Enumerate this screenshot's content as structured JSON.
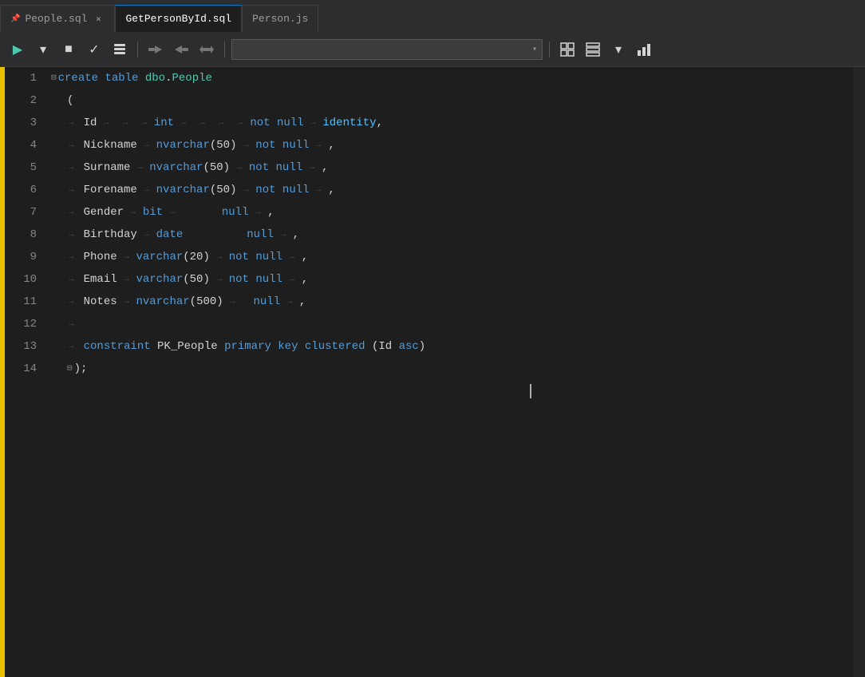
{
  "tabs": [
    {
      "id": "people-sql",
      "label": "People.sql",
      "active": false,
      "pinned": true,
      "closable": true
    },
    {
      "id": "getpersonbyid-sql",
      "label": "GetPersonById.sql",
      "active": true,
      "pinned": false,
      "closable": false
    },
    {
      "id": "person-js",
      "label": "Person.js",
      "active": false,
      "pinned": false,
      "closable": false
    }
  ],
  "toolbar": {
    "play_icon": "▶",
    "dropdown_icon": "▾",
    "stop_icon": "■",
    "check_icon": "✓",
    "db_icon": "🗄",
    "conn_left_icon": "⟵",
    "conn_right_icon": "⟶",
    "conn_both_icon": "↔",
    "dropdown_placeholder": "",
    "grid_icon": "▦",
    "table_icon": "⊞",
    "stats_icon": "📊"
  },
  "code": {
    "lines": [
      {
        "num": 1,
        "fold": true,
        "content": "create_table_dbo_people"
      },
      {
        "num": 2,
        "fold": false,
        "content": "open_paren"
      },
      {
        "num": 3,
        "fold": false,
        "content": "id_row"
      },
      {
        "num": 4,
        "fold": false,
        "content": "nickname_row"
      },
      {
        "num": 5,
        "fold": false,
        "content": "surname_row"
      },
      {
        "num": 6,
        "fold": false,
        "content": "forename_row"
      },
      {
        "num": 7,
        "fold": false,
        "content": "gender_row"
      },
      {
        "num": 8,
        "fold": false,
        "content": "birthday_row"
      },
      {
        "num": 9,
        "fold": false,
        "content": "phone_row"
      },
      {
        "num": 10,
        "fold": false,
        "content": "email_row"
      },
      {
        "num": 11,
        "fold": false,
        "content": "notes_row"
      },
      {
        "num": 12,
        "fold": false,
        "content": "empty"
      },
      {
        "num": 13,
        "fold": false,
        "content": "constraint_row"
      },
      {
        "num": 14,
        "fold": false,
        "content": "close_row"
      }
    ]
  }
}
